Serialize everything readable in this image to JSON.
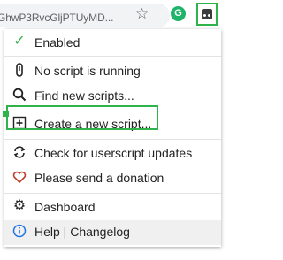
{
  "browser": {
    "url": "GhwP3RvcGljPTUyMD..."
  },
  "menu": {
    "items": [
      {
        "label": "Enabled",
        "icon": "checkmark-icon"
      },
      {
        "label": "No script is running",
        "icon": "script-icon"
      },
      {
        "label": "Find new scripts...",
        "icon": "search-icon"
      },
      {
        "label": "Create a new script...",
        "icon": "plus-square-icon"
      },
      {
        "label": "Check for userscript updates",
        "icon": "refresh-icon"
      },
      {
        "label": "Please send a donation",
        "icon": "heart-icon"
      },
      {
        "label": "Dashboard",
        "icon": "gear-icon"
      },
      {
        "label": "Help | Changelog",
        "icon": "info-icon"
      }
    ]
  },
  "colors": {
    "highlight": "#2fb34a",
    "check": "#2fb34a",
    "heart": "#c0392b",
    "info": "#1a73e8"
  }
}
